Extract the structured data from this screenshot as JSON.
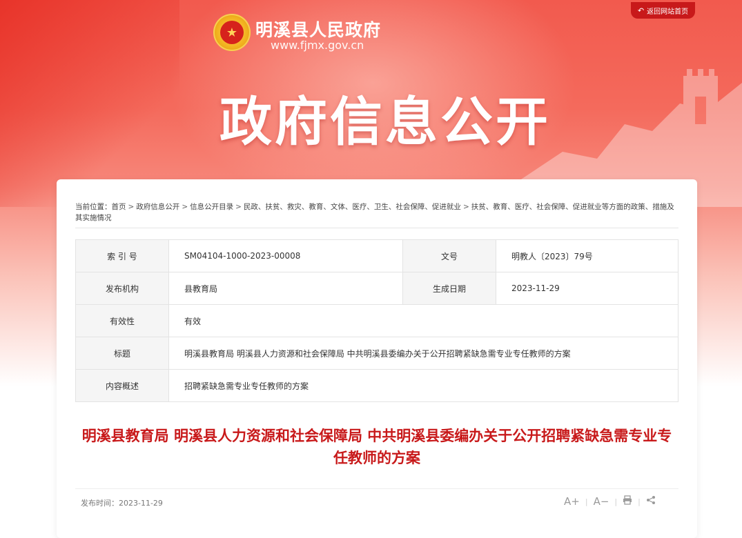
{
  "header": {
    "return_label": "返回网站首页",
    "site_name": "明溪县人民政府",
    "site_url": "www.fjmx.gov.cn",
    "banner_title": "政府信息公开"
  },
  "breadcrumb": {
    "prefix": "当前位置：",
    "items": [
      "首页",
      "政府信息公开",
      "信息公开目录",
      "民政、扶贫、救灾、教育、文体、医疗、卫生、社会保障、促进就业",
      "扶贫、教育、医疗、社会保障、促进就业等方面的政策、措施及其实施情况"
    ],
    "separator": ">"
  },
  "meta": {
    "index_label": "索 引 号",
    "index_value": "SM04104-1000-2023-00008",
    "docno_label": "文号",
    "docno_value": "明教人〔2023〕79号",
    "org_label": "发布机构",
    "org_value": "县教育局",
    "date_label": "生成日期",
    "date_value": "2023-11-29",
    "valid_label": "有效性",
    "valid_value": "有效",
    "title_label": "标题",
    "title_value": "明溪县教育局 明溪县人力资源和社会保障局 中共明溪县委编办关于公开招聘紧缺急需专业专任教师的方案",
    "summary_label": "内容概述",
    "summary_value": "招聘紧缺急需专业专任教师的方案"
  },
  "article": {
    "title": "明溪县教育局 明溪县人力资源和社会保障局 中共明溪县委编办关于公开招聘紧缺急需专业专任教师的方案",
    "pub_label": "发布时间：",
    "pub_date": "2023-11-29"
  },
  "tools": {
    "font_up": "A+",
    "font_down": "A−",
    "print_icon": "print-icon",
    "share_icon": "share-icon"
  },
  "colors": {
    "brand_red": "#c8191a",
    "banner_red": "#f25a4e"
  }
}
